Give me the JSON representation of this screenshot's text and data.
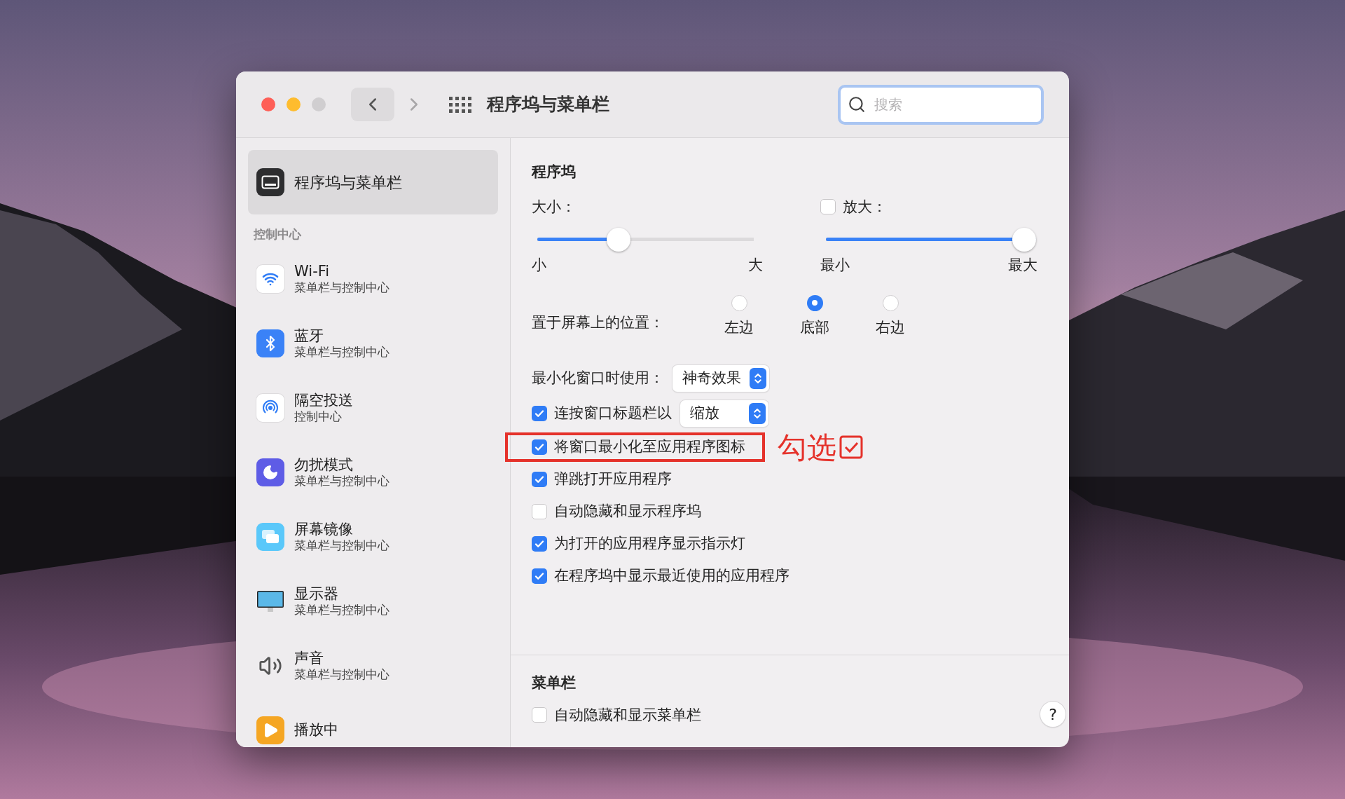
{
  "window": {
    "title": "程序坞与菜单栏",
    "search": {
      "placeholder": "搜索"
    }
  },
  "sidebar": {
    "items": [
      {
        "title": "程序坞与菜单栏",
        "kind": "dock",
        "selected": true
      }
    ],
    "section": "控制中心",
    "section_items": [
      {
        "title": "Wi-Fi",
        "subtitle": "菜单栏与控制中心",
        "kind": "wifi",
        "selected": false
      },
      {
        "title": "蓝牙",
        "subtitle": "菜单栏与控制中心",
        "kind": "bluetooth",
        "selected": false
      },
      {
        "title": "隔空投送",
        "subtitle": "控制中心",
        "kind": "airdrop",
        "selected": false
      },
      {
        "title": "勿扰模式",
        "subtitle": "菜单栏与控制中心",
        "kind": "moon",
        "selected": false
      },
      {
        "title": "屏幕镜像",
        "subtitle": "菜单栏与控制中心",
        "kind": "mirror",
        "selected": false
      },
      {
        "title": "显示器",
        "subtitle": "菜单栏与控制中心",
        "kind": "display",
        "selected": false
      },
      {
        "title": "声音",
        "subtitle": "菜单栏与控制中心",
        "kind": "sound",
        "selected": false
      },
      {
        "title": "播放中",
        "kind": "play",
        "selected": false
      }
    ]
  },
  "dock": {
    "heading": "程序坞",
    "size": {
      "label": "大小：",
      "level": 0.36,
      "min": "小",
      "max": "大"
    },
    "magnification": {
      "label": "放大：",
      "checked": false,
      "level": 1,
      "min": "最小",
      "max": "最大"
    },
    "position": {
      "label": "置于屏幕上的位置：",
      "options": [
        {
          "label": "左边",
          "selected": false
        },
        {
          "label": "底部",
          "selected": true
        },
        {
          "label": "右边",
          "selected": false
        }
      ]
    },
    "minimize": {
      "label": "最小化窗口时使用：",
      "value": "神奇效果"
    },
    "double_click": {
      "label": "连按窗口标题栏以",
      "checked": true,
      "value": "缩放"
    },
    "options": [
      {
        "label": "将窗口最小化至应用程序图标",
        "checked": true,
        "highlighted": true
      },
      {
        "label": "弹跳打开应用程序",
        "checked": true,
        "highlighted": false
      },
      {
        "label": "自动隐藏和显示程序坞",
        "checked": false,
        "highlighted": false
      },
      {
        "label": "为打开的应用程序显示指示灯",
        "checked": true,
        "highlighted": false
      },
      {
        "label": "在程序坞中显示最近使用的应用程序",
        "checked": true,
        "highlighted": false
      }
    ]
  },
  "annotation": {
    "text": "勾选"
  },
  "menu_bar": {
    "heading": "菜单栏",
    "options": [
      {
        "label": "自动隐藏和显示菜单栏",
        "checked": false
      }
    ]
  },
  "help": {
    "label": "?"
  }
}
